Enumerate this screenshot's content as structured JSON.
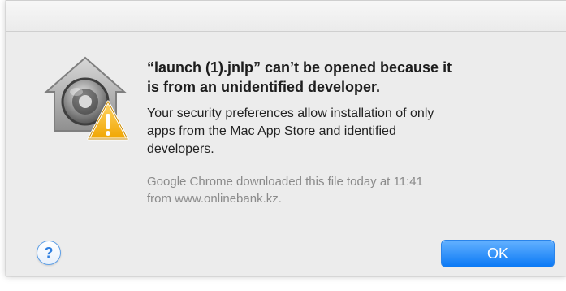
{
  "dialog": {
    "title": "“launch (1).jnlp” can’t be opened because it\nis from an unidentified developer.",
    "message": "Your security preferences allow installation of only\napps from the Mac App Store and identified\ndevelopers.",
    "source": "Google Chrome downloaded this file today at 11:41\nfrom www.onlinebank.kz.",
    "help_glyph": "?",
    "ok_label": "OK"
  },
  "icons": {
    "app_icon": "security-lock-warning-icon",
    "help_icon": "help-icon"
  },
  "colors": {
    "ok_button": "#1b86f7",
    "warning": "#f6b71b",
    "help": "#2f7fe0"
  }
}
